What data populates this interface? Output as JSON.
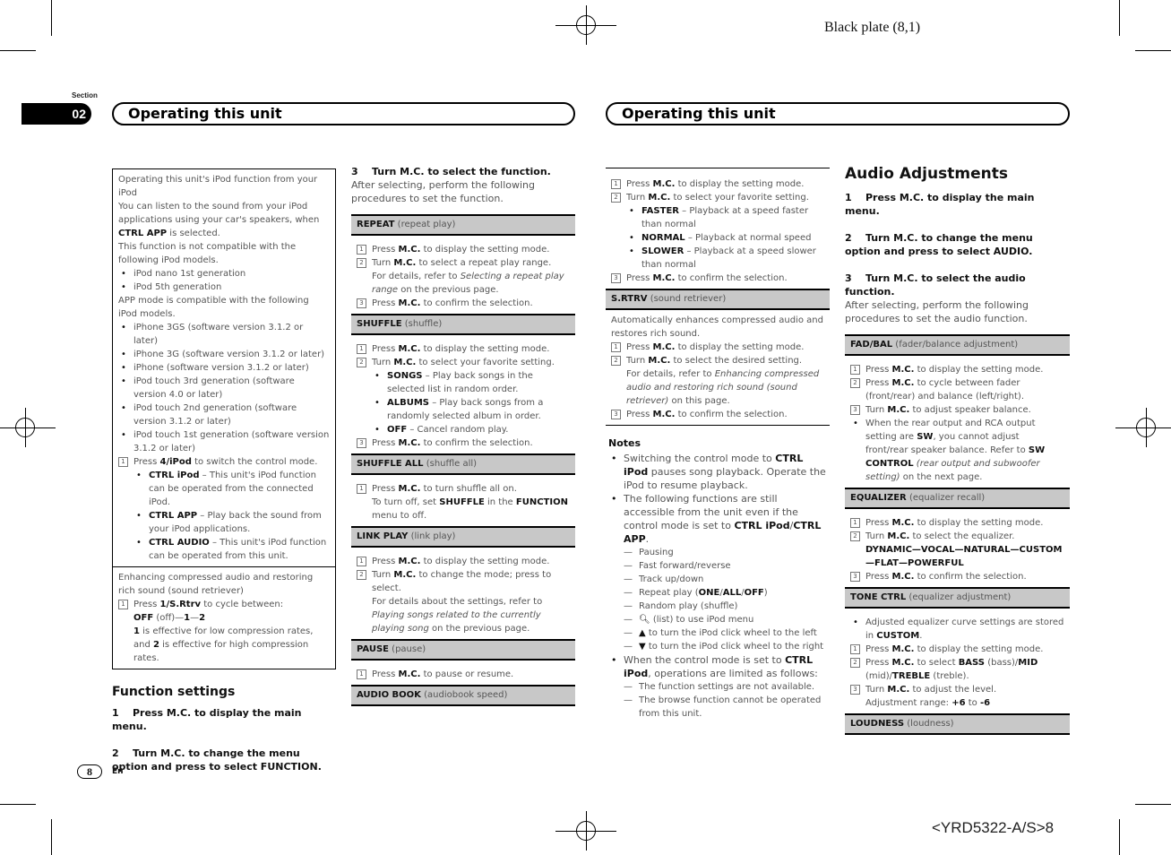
{
  "print": {
    "plate": "Black plate (8,1)",
    "code": "<YRD5322-A/S>8"
  },
  "header": {
    "section_label": "Section",
    "section_number": "02",
    "left_title": "Operating this unit",
    "right_title": "Operating this unit"
  },
  "footer": {
    "page_number": "8",
    "language": "En"
  },
  "col1": {
    "box1_title": "Operating this unit's iPod function from your iPod",
    "p1a": "You can listen to the sound from your iPod applications using your car's speakers, when ",
    "p1b": "CTRL APP",
    "p1c": " is selected.",
    "p2": "This function is not compatible with the following iPod models.",
    "incompatible": [
      "iPod nano 1st generation",
      "iPod 5th generation"
    ],
    "p3": "APP mode is compatible with the following iPod models.",
    "compatible": [
      "iPhone 3GS (software version 3.1.2 or later)",
      "iPhone 3G (software version 3.1.2 or later)",
      "iPhone (software version 3.1.2 or later)",
      "iPod touch 3rd generation (software version 4.0 or later)",
      "iPod touch 2nd generation (software version 3.1.2 or later)",
      "iPod touch 1st generation (software version 3.1.2 or later)"
    ],
    "step1a": "Press ",
    "step1b": "4/iPod",
    "step1c": " to switch the control mode.",
    "modes": [
      {
        "name": "CTRL iPod",
        "desc": " – This unit's iPod function can be operated from the connected iPod."
      },
      {
        "name": "CTRL APP",
        "desc": " – Play back the sound from your iPod applications."
      },
      {
        "name": "CTRL AUDIO",
        "desc": " – This unit's iPod function can be operated from this unit."
      }
    ],
    "box2_title": "Enhancing compressed audio and restoring rich sound (sound retriever)",
    "srtrv_a": "Press ",
    "srtrv_b": "1/S.Rtrv",
    "srtrv_c": " to cycle between:",
    "srtrv_off": "OFF",
    "srtrv_off2": " (off)—",
    "srtrv_1": "1",
    "srtrv_dash": "—",
    "srtrv_2": "2",
    "srtrv_n1": "1",
    "srtrv_t1": " is effective for low compression rates, and ",
    "srtrv_n2": "2",
    "srtrv_t2": " is effective for high compression rates.",
    "fs_heading": "Function settings",
    "fs_step1": "1    Press M.C. to display the main menu.",
    "fs_step2": "2    Turn M.C. to change the menu option and press to select FUNCTION."
  },
  "col2": {
    "step3": "3    Turn M.C. to select the function.",
    "intro": "After selecting, perform the following procedures to set the function.",
    "repeat": {
      "name": "REPEAT",
      "desc": " (repeat play)"
    },
    "repeat_s1": "to display the setting mode.",
    "repeat_s2": "to select a repeat play range.",
    "repeat_s2_detail_a": "For details, refer to ",
    "repeat_s2_detail_i": "Selecting a repeat play range",
    "repeat_s2_detail_b": " on the previous page.",
    "repeat_s3": "to confirm the selection.",
    "shuffle": {
      "name": "SHUFFLE",
      "desc": " (shuffle)"
    },
    "shuffle_s1": "to display the setting mode.",
    "shuffle_s2": "to select your favorite setting.",
    "shuffle_opts": [
      {
        "name": "SONGS",
        "desc": " – Play back songs in the selected list in random order."
      },
      {
        "name": "ALBUMS",
        "desc": " – Play back songs from a randomly selected album in order."
      },
      {
        "name": "OFF",
        "desc": " – Cancel random play."
      }
    ],
    "shuffle_s3": "to confirm the selection.",
    "shuffle_all": {
      "name": "SHUFFLE ALL",
      "desc": " (shuffle all)"
    },
    "sa_s1": "to turn shuffle all on.",
    "sa_off_a": "To turn off, set ",
    "sa_off_b": "SHUFFLE",
    "sa_off_c": " in the ",
    "sa_off_d": "FUNCTION",
    "sa_off_e": " menu to off.",
    "link_play": {
      "name": "LINK PLAY",
      "desc": " (link play)"
    },
    "lp_s1": "to display the setting mode.",
    "lp_s2": "to change the mode; press to select.",
    "lp_detail_a": "For details about the settings, refer to ",
    "lp_detail_i": "Playing songs related to the currently playing song",
    "lp_detail_b": " on the previous page.",
    "pause": {
      "name": "PAUSE",
      "desc": " (pause)"
    },
    "pause_s1": "to pause or resume.",
    "audio_book": {
      "name": "AUDIO BOOK",
      "desc": " (audiobook speed)"
    }
  },
  "col3": {
    "ab_s1": "to display the setting mode.",
    "ab_s2": "to select your favorite setting.",
    "ab_opts": [
      {
        "name": "FASTER",
        "desc": " – Playback at a speed faster than normal"
      },
      {
        "name": "NORMAL",
        "desc": " – Playback at normal speed"
      },
      {
        "name": "SLOWER",
        "desc": " – Playback at a speed slower than normal"
      }
    ],
    "ab_s3": "to confirm the selection.",
    "srtrv": {
      "name": "S.RTRV",
      "desc": " (sound retriever)"
    },
    "srtrv_intro": "Automatically enhances compressed audio and restores rich sound.",
    "sr_s1": "to display the setting mode.",
    "sr_s2": "to select the desired setting.",
    "sr_detail_a": "For details, refer to ",
    "sr_detail_i": "Enhancing compressed audio and restoring rich sound (sound retriever)",
    "sr_detail_b": " on this page.",
    "sr_s3": "to confirm the selection.",
    "notes_heading": "Notes",
    "note1_a": "Switching the control mode to ",
    "note1_b": "CTRL iPod",
    "note1_c": " pauses song playback. Operate the iPod to resume playback.",
    "note2_a": "The following functions are still accessible from the unit even if the control mode is set to ",
    "note2_b": "CTRL iPod",
    "note2_c": "/",
    "note2_d": "CTRL APP",
    "note2_e": ".",
    "accessible": [
      "Pausing",
      "Fast forward/reverse",
      "Track up/down"
    ],
    "repeat_a": "Repeat play (",
    "repeat_one": "ONE",
    "repeat_all": "ALL",
    "repeat_off": "OFF",
    "repeat_z": ")",
    "random": "Random play (shuffle)",
    "list": " (list) to use iPod menu",
    "up": " to turn the iPod click wheel to the left",
    "down": " to turn the iPod click wheel to the right",
    "note3_a": "When the control mode is set to ",
    "note3_b": "CTRL iPod",
    "note3_c": ", operations are limited as follows:",
    "limited": [
      "The function settings are not available.",
      "The browse function cannot be operated from this unit."
    ]
  },
  "col4": {
    "heading": "Audio Adjustments",
    "step1": "1    Press M.C. to display the main menu.",
    "step2": "2    Turn M.C. to change the menu option and press to select AUDIO.",
    "step3": "3    Turn M.C. to select the audio function.",
    "intro": "After selecting, perform the following procedures to set the audio function.",
    "fadbal": {
      "name": "FAD/BAL",
      "desc": " (fader/balance adjustment)"
    },
    "fb_s1": "to display the setting mode.",
    "fb_s2": "to cycle between fader (front/rear) and balance (left/right).",
    "fb_s3": "to adjust speaker balance.",
    "fb_note_a": "When the rear output and RCA output setting are ",
    "fb_note_b": "SW",
    "fb_note_c": ", you cannot adjust front/rear speaker balance. Refer to ",
    "fb_note_d": "SW CONTROL",
    "fb_note_i": " (rear output and subwoofer setting)",
    "fb_note_e": " on the next page.",
    "eq": {
      "name": "EQUALIZER",
      "desc": " (equalizer recall)"
    },
    "eq_s1": "to display the setting mode.",
    "eq_s2": "to select the equalizer.",
    "eq_list": "DYNAMIC—VOCAL—NATURAL—CUSTOM—FLAT—POWERFUL",
    "eq_s3": "to confirm the selection.",
    "tone": {
      "name": "TONE CTRL",
      "desc": " (equalizer adjustment)"
    },
    "tone_note_a": "Adjusted equalizer curve settings are stored in ",
    "tone_note_b": "CUSTOM",
    "tone_note_c": ".",
    "tone_s1": "to display the setting mode.",
    "tone_s2_a": "to select ",
    "tone_bass": "BASS",
    "tone_bass_d": " (bass)/",
    "tone_mid": "MID",
    "tone_mid_d": " (mid)/",
    "tone_treble": "TREBLE",
    "tone_treble_d": " (treble).",
    "tone_s3": "to adjust the level.",
    "range_a": "Adjustment range: ",
    "range_hi": "+6",
    "range_to": " to ",
    "range_lo": "-6",
    "loudness": {
      "name": "LOUDNESS",
      "desc": " (loudness)"
    }
  },
  "common": {
    "press": "Press ",
    "turn": "Turn ",
    "mc": "M.C.",
    "n1": "1",
    "n2": "2",
    "n3": "3"
  }
}
